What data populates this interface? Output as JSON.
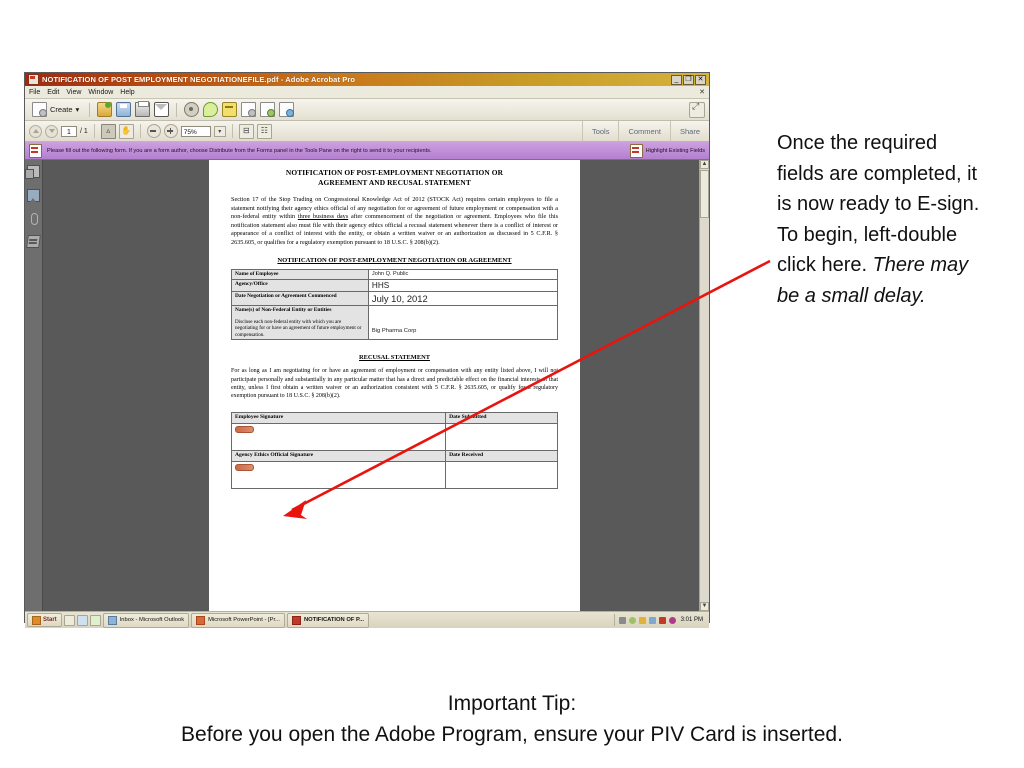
{
  "acrobat": {
    "title": "NOTIFICATION OF POST EMPLOYMENT NEGOTIATIONEFILE.pdf - Adobe Acrobat Pro",
    "window_buttons": [
      "_",
      "❐",
      "✕"
    ],
    "menu": [
      "File",
      "Edit",
      "View",
      "Window",
      "Help"
    ],
    "menu_close": "✕",
    "toolbar": {
      "create_label": "Create",
      "create_caret": "▾",
      "icons": [
        "open-folder-icon",
        "save-icon",
        "print-icon",
        "email-icon",
        "secure-icon",
        "comment-icon",
        "stamp-icon",
        "doc-icon",
        "doc-export-icon",
        "doc-sign-icon"
      ],
      "expand_icon": "⤢"
    },
    "navbar": {
      "page_current": "1",
      "page_total": "/ 1",
      "zoom_value": "75%",
      "zoom_caret": "▾",
      "right_items": [
        "Tools",
        "Comment",
        "Share"
      ]
    },
    "notice": {
      "text": "Please fill out the following form. If you are a form author, choose Distribute from the Forms panel in the Tools Pane on the right to send it to your recipients.",
      "highlight_label": "Highlight Existing Fields"
    },
    "navpane_icons": [
      "page-thumbnails-icon",
      "bookmarks-icon",
      "attachments-icon",
      "signatures-icon"
    ],
    "scroll": {
      "up": "▲",
      "down": "▼"
    }
  },
  "document": {
    "heading_line1": "NOTIFICATION OF POST-EMPLOYMENT NEGOTIATION OR",
    "heading_line2": "AGREEMENT AND RECUSAL STATEMENT",
    "intro_part1": "Section 17 of the Stop Trading on Congressional Knowledge Act of 2012 (STOCK Act) requires certain employees to file a statement notifying their agency ethics official of any negotiation for or agreement of future employment or compensation with a non-federal entity within ",
    "intro_underline": "three business days",
    "intro_part2": " after commencement of the negotiation or agreement.  Employees who file this notification statement also must file with their agency ethics official a recusal statement whenever there is a conflict of interest or appearance of a conflict of interest with the entity, or obtain a written waiver or an authorization as discussed in 5 C.F.R. § 2635.605, or qualifies for a regulatory exemption pursuant to 18 U.S.C. § 208(b)(2).",
    "section_heading": "NOTIFICATION OF POST-EMPLOYMENT NEGOTIATION OR AGREEMENT",
    "form_rows": [
      {
        "label": "Name of Employee",
        "sub": "",
        "value": "John Q. Public",
        "size": "sm"
      },
      {
        "label": "Agency/Office",
        "sub": "",
        "value": "HHS",
        "size": "md"
      },
      {
        "label": "Date Negotiation or Agreement Commenced",
        "sub": "",
        "value": "July 10, 2012",
        "size": "lg"
      },
      {
        "label": "Name(s) of Non-Federal Entity or Entities",
        "sub": "Disclose each non-federal entity with which you are negotiating for or have an agreement of future employment or compensation.",
        "value": "Big Pharma Corp",
        "size": "entity"
      }
    ],
    "recusal_heading": "RECUSAL STATEMENT",
    "recusal_text": "For as long as I am negotiating for or have an agreement of employment or compensation with any entity listed above, I will not participate personally and substantially in any particular matter that has a direct and predictable effect on the financial interests of that entity, unless I first obtain a written waiver or an authorization consistent with 5 C.F.R. § 2635.605, or qualify for a regulatory exemption pursuant to 18 U.S.C. § 208(b)(2).",
    "signature_rows": [
      {
        "left_label": "Employee Signature",
        "right_label": "Date Submitted"
      },
      {
        "left_label": "Agency Ethics Official Signature",
        "right_label": "Date Received"
      }
    ]
  },
  "taskbar": {
    "start_label": "Start",
    "tasks": [
      {
        "label": "Inbox - Microsoft Outlook",
        "icon": "outlook-icon",
        "active": false
      },
      {
        "label": "Microsoft PowerPoint - [Pr...",
        "icon": "powerpoint-icon",
        "active": false
      },
      {
        "label": "NOTIFICATION OF P...",
        "icon": "acrobat-icon",
        "active": true
      }
    ],
    "clock": "3:01 PM"
  },
  "callout": {
    "text_plain": "Once the required fields are completed, it is now ready to E-sign.  To begin, left-double click here.  ",
    "text_italic": "There may be a small delay."
  },
  "caption": {
    "line1": "Important Tip:",
    "line2": "Before you open the Adobe Program, ensure your PIV Card is inserted."
  },
  "colors": {
    "arrow": "#e8150f",
    "title_start": "#9e2a10",
    "title_end": "#d4b33c",
    "notice_bar": "#b47fd0",
    "viewport_bg": "#595959",
    "signature_field": "#d07a52"
  }
}
